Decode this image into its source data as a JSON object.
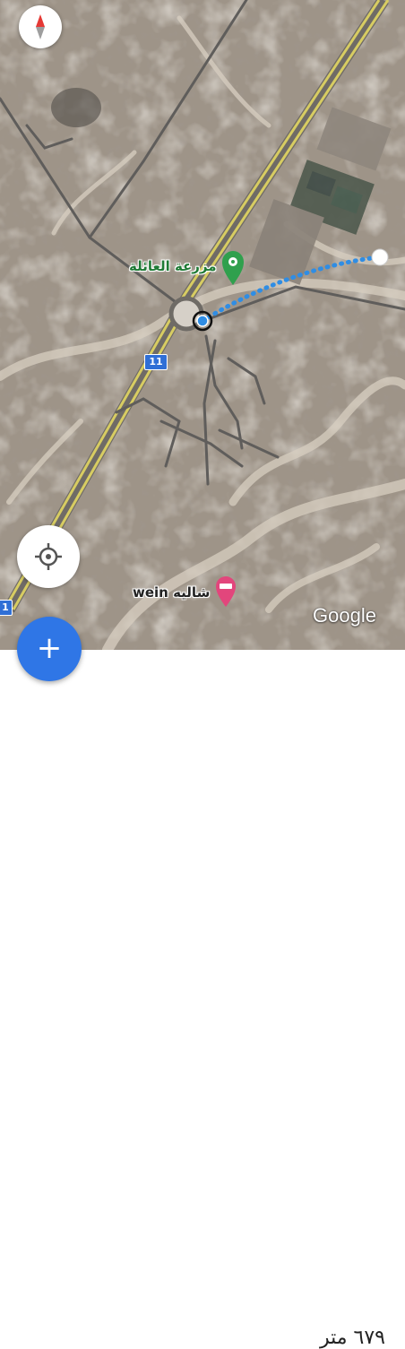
{
  "map": {
    "road_shield": "11",
    "road_shield_edge": "1",
    "attribution": "Google",
    "pois": [
      {
        "name": "مزرعة العائلة",
        "icon": "flower-pin-icon",
        "color": "#1f7a35"
      },
      {
        "name": "شاليه wein",
        "icon": "bed-pin-icon",
        "color": "#e2467c"
      }
    ],
    "route_color": "#2f8de4"
  },
  "controls": {
    "compass_icon": "compass-icon",
    "locate_icon": "my-location-icon",
    "fab_label": "+",
    "fab_color": "#2f76e6"
  },
  "info": {
    "distance": "٦٧٩ متر"
  }
}
